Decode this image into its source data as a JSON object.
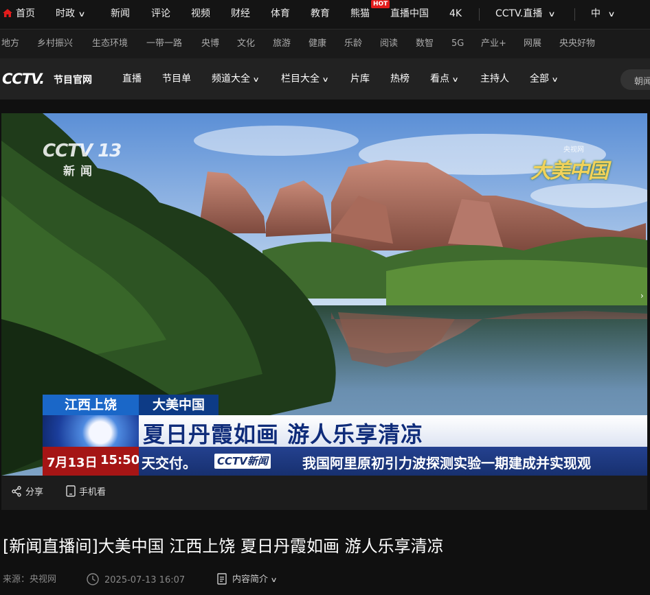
{
  "topnav": {
    "items": [
      "首页",
      "时政",
      "新闻",
      "评论",
      "视频",
      "财经",
      "体育",
      "教育",
      "熊猫",
      "直播中国",
      "4K"
    ],
    "hot_badge": "HOT",
    "cctv_live": "CCTV.直播",
    "lang": "中"
  },
  "subnav": {
    "items": [
      "地方",
      "乡村振兴",
      "生态环境",
      "一带一路",
      "央博",
      "文化",
      "旅游",
      "健康",
      "乐龄",
      "阅读",
      "数智",
      "5G",
      "产业+",
      "网展",
      "央央好物"
    ]
  },
  "brandbar": {
    "logo": "CCTV.",
    "logo_sub": "节目官网",
    "items": [
      "直播",
      "节目单",
      "频道大全",
      "栏目大全",
      "片库",
      "热榜",
      "看点",
      "主持人",
      "全部"
    ],
    "search_placeholder": "朝闻"
  },
  "video": {
    "watermark_channel": "CCTV 13",
    "watermark_channel_name": "新闻",
    "watermark_site": "央视网",
    "watermark_program": "大美中国",
    "location_tag": "江西上饶",
    "program_tag": "大美中国",
    "headline": "夏日丹霞如画 游人乐享清凉",
    "date": "7月13日",
    "time": "15:50",
    "ticker_left": "天交付。",
    "ticker_logo": "CCTV新闻",
    "ticker_right": "我国阿里原初引力波探测实验一期建成并实现观"
  },
  "controls": {
    "share": "分享",
    "mobile": "手机看"
  },
  "page": {
    "title": "[新闻直播间]大美中国 江西上饶 夏日丹霞如画 游人乐享清凉",
    "source": "来源：央视网",
    "datetime": "2025-07-13 16:07",
    "intro": "内容简介"
  },
  "colors": {
    "accent_red": "#e21c1c",
    "headline_blue": "#0f2c7a",
    "ticker_blue": "#17306f",
    "clock_red": "#a51515"
  }
}
